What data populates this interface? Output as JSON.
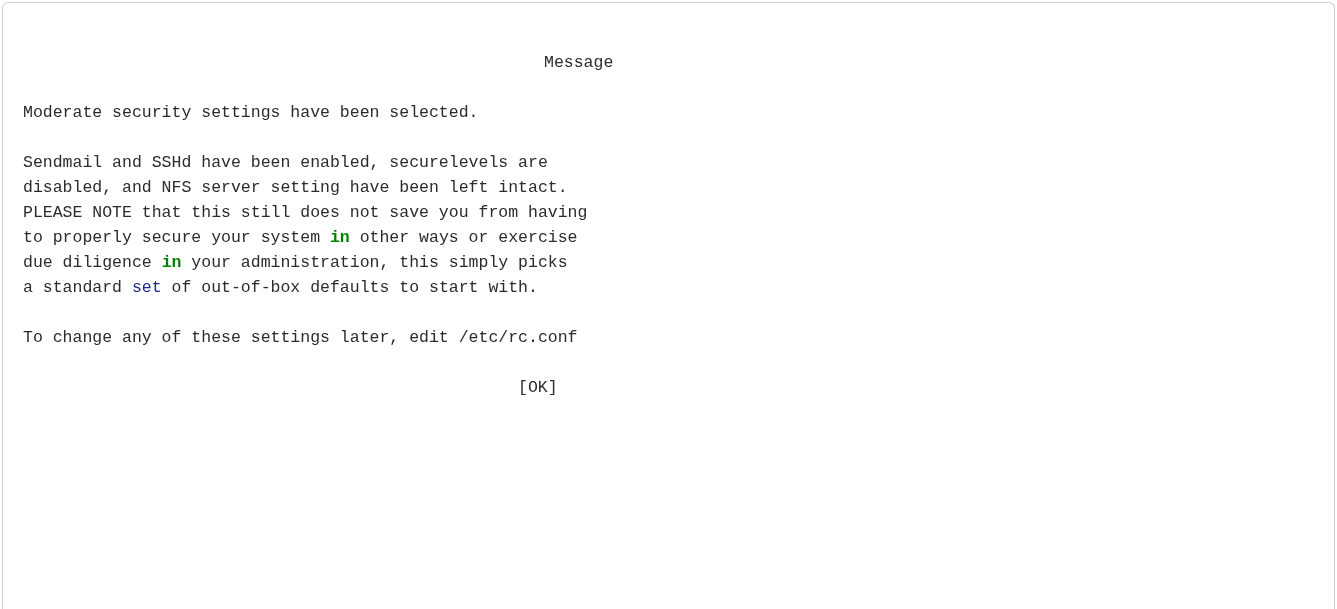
{
  "code_block": {
    "lines": [
      {
        "kind": "heading",
        "segments": [
          {
            "text": "Message",
            "kind": "plain"
          }
        ]
      },
      {
        "kind": "blank"
      },
      {
        "kind": "text",
        "segments": [
          {
            "text": "Moderate security settings have been selected.",
            "kind": "plain"
          }
        ]
      },
      {
        "kind": "blank"
      },
      {
        "kind": "text",
        "segments": [
          {
            "text": "Sendmail and SSHd have been enabled, securelevels are",
            "kind": "plain"
          }
        ]
      },
      {
        "kind": "text",
        "segments": [
          {
            "text": "disabled, and NFS server setting have been left intact.",
            "kind": "plain"
          }
        ]
      },
      {
        "kind": "text",
        "segments": [
          {
            "text": "PLEASE NOTE that this still does not save you from having",
            "kind": "plain"
          }
        ]
      },
      {
        "kind": "text",
        "segments": [
          {
            "text": "to properly secure your system ",
            "kind": "plain"
          },
          {
            "text": "in",
            "kind": "keyword"
          },
          {
            "text": " other ways or exercise",
            "kind": "plain"
          }
        ]
      },
      {
        "kind": "text",
        "segments": [
          {
            "text": "due diligence ",
            "kind": "plain"
          },
          {
            "text": "in",
            "kind": "keyword"
          },
          {
            "text": " your administration, this simply picks",
            "kind": "plain"
          }
        ]
      },
      {
        "kind": "text",
        "segments": [
          {
            "text": "a standard ",
            "kind": "plain"
          },
          {
            "text": "set",
            "kind": "builtin"
          },
          {
            "text": " of out-of-box defaults to start with.",
            "kind": "plain"
          }
        ]
      },
      {
        "kind": "blank"
      },
      {
        "kind": "text",
        "segments": [
          {
            "text": "To change any of these settings later, edit /etc/rc.conf",
            "kind": "plain"
          }
        ]
      },
      {
        "kind": "blank"
      },
      {
        "kind": "button",
        "segments": [
          {
            "text": "[OK]",
            "kind": "plain"
          }
        ]
      }
    ]
  }
}
